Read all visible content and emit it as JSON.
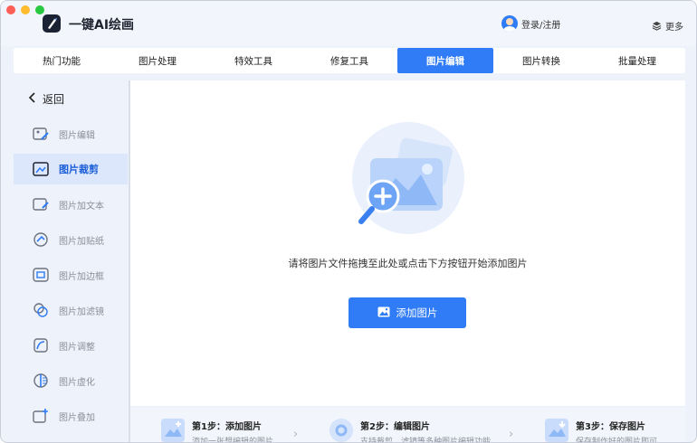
{
  "app": {
    "title": "一键AI绘画",
    "login_label": "登录/注册",
    "more_label": "更多"
  },
  "tabs": [
    {
      "label": "热门功能",
      "active": false
    },
    {
      "label": "图片处理",
      "active": false
    },
    {
      "label": "特效工具",
      "active": false
    },
    {
      "label": "修复工具",
      "active": false
    },
    {
      "label": "图片编辑",
      "active": true
    },
    {
      "label": "图片转换",
      "active": false
    },
    {
      "label": "批量处理",
      "active": false
    }
  ],
  "sidebar": {
    "back_label": "返回",
    "items": [
      {
        "label": "图片编辑",
        "icon": "image-edit-icon",
        "active": false
      },
      {
        "label": "图片裁剪",
        "icon": "crop-icon",
        "active": true
      },
      {
        "label": "图片加文本",
        "icon": "add-text-icon",
        "active": false
      },
      {
        "label": "图片加贴纸",
        "icon": "sticker-icon",
        "active": false
      },
      {
        "label": "图片加边框",
        "icon": "frame-icon",
        "active": false
      },
      {
        "label": "图片加滤镜",
        "icon": "filter-icon",
        "active": false
      },
      {
        "label": "图片调整",
        "icon": "adjust-icon",
        "active": false
      },
      {
        "label": "图片虚化",
        "icon": "blur-icon",
        "active": false
      },
      {
        "label": "图片叠加",
        "icon": "overlay-icon",
        "active": false
      }
    ]
  },
  "main": {
    "hint": "请将图片文件拖拽至此处或点击下方按钮开始添加图片",
    "add_button_label": "添加图片"
  },
  "steps": [
    {
      "title": "第1步：添加图片",
      "desc": "添加一张想编辑的图片"
    },
    {
      "title": "第2步：编辑图片",
      "desc": "支持裁剪、滤镜等多种图片编辑功能"
    },
    {
      "title": "第3步：保存图片",
      "desc": "保存制作好的图片即可"
    }
  ],
  "colors": {
    "accent": "#2f7cf6",
    "sidebar_active_bg": "#dde7fb",
    "sidebar_active_text": "#1c5fd8"
  }
}
